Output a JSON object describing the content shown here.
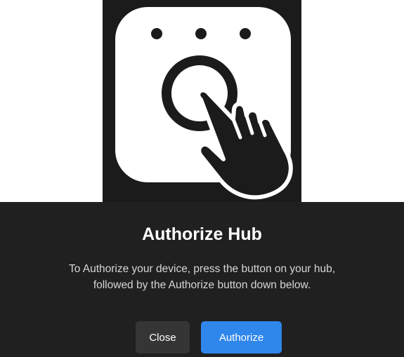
{
  "illustration": {
    "icon": "hub-press-button-icon",
    "background_color": "#1b1b1b",
    "foreground_color": "#ffffff"
  },
  "dialog": {
    "title": "Authorize Hub",
    "message_line1": "To Authorize your device, press the button on your hub,",
    "message_line2": "followed by the Authorize button down below.",
    "background_color": "#202020"
  },
  "buttons": {
    "close_label": "Close",
    "authorize_label": "Authorize",
    "close_color": "#353535",
    "authorize_color": "#2f86eb"
  }
}
